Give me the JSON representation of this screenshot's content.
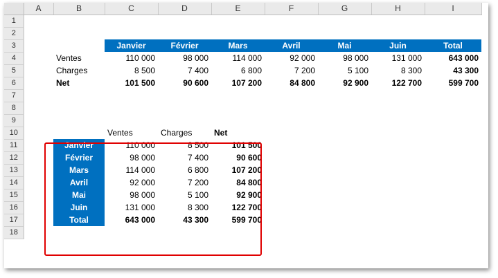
{
  "columns": [
    "A",
    "B",
    "C",
    "D",
    "E",
    "F",
    "G",
    "H",
    "I"
  ],
  "rows": [
    "1",
    "2",
    "3",
    "4",
    "5",
    "6",
    "7",
    "8",
    "9",
    "10",
    "11",
    "12",
    "13",
    "14",
    "15",
    "16",
    "17",
    "18"
  ],
  "table1": {
    "headers": [
      "Janvier",
      "Février",
      "Mars",
      "Avril",
      "Mai",
      "Juin",
      "Total"
    ],
    "rows": [
      {
        "label": "Ventes",
        "values": [
          "110 000",
          "98 000",
          "114 000",
          "92 000",
          "98 000",
          "131 000",
          "643 000"
        ]
      },
      {
        "label": "Charges",
        "values": [
          "8 500",
          "7 400",
          "6 800",
          "7 200",
          "5 100",
          "8 300",
          "43 300"
        ]
      },
      {
        "label": "Net",
        "values": [
          "101 500",
          "90 600",
          "107 200",
          "84 800",
          "92 900",
          "122 700",
          "599 700"
        ]
      }
    ]
  },
  "table2": {
    "headers": [
      "Ventes",
      "Charges",
      "Net"
    ],
    "rows": [
      {
        "label": "Janvier",
        "values": [
          "110 000",
          "8 500",
          "101 500"
        ]
      },
      {
        "label": "Février",
        "values": [
          "98 000",
          "7 400",
          "90 600"
        ]
      },
      {
        "label": "Mars",
        "values": [
          "114 000",
          "6 800",
          "107 200"
        ]
      },
      {
        "label": "Avril",
        "values": [
          "92 000",
          "7 200",
          "84 800"
        ]
      },
      {
        "label": "Mai",
        "values": [
          "98 000",
          "5 100",
          "92 900"
        ]
      },
      {
        "label": "Juin",
        "values": [
          "131 000",
          "8 300",
          "122 700"
        ]
      },
      {
        "label": "Total",
        "values": [
          "643 000",
          "43 300",
          "599 700"
        ]
      }
    ]
  },
  "colors": {
    "header_fill": "#0070c0",
    "highlight_border": "#e00000",
    "sheet_header": "#eaeaea"
  }
}
